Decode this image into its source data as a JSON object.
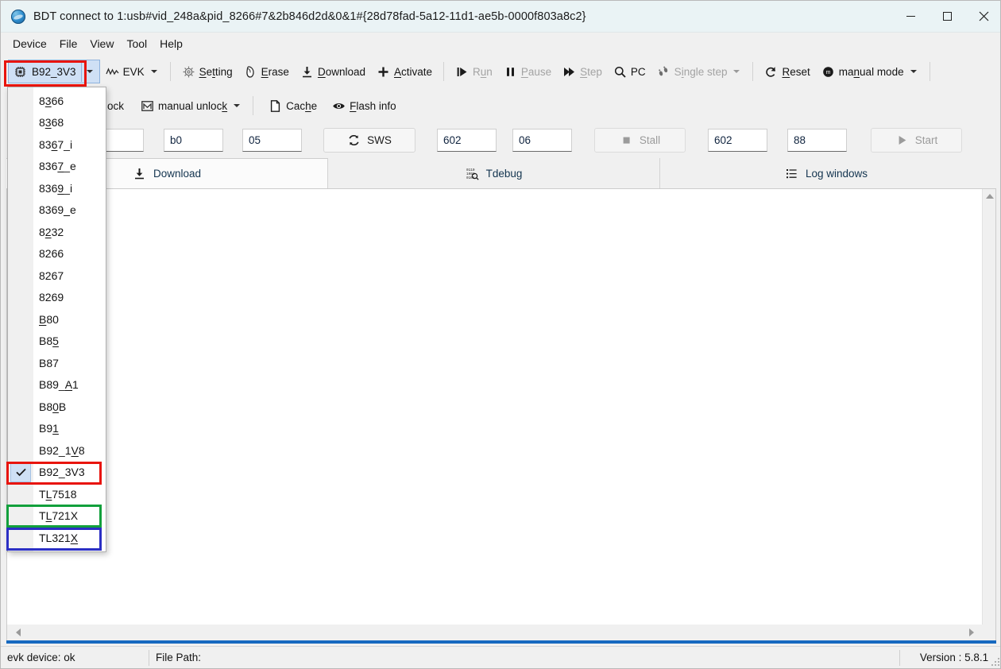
{
  "window": {
    "title": "BDT connect to 1:usb#vid_248a&pid_8266#7&2b846d2d&0&1#{28d78fad-5a12-11d1-ae5b-0000f803a8c2}",
    "app_icon": "globe-icon",
    "minimize_label": "─",
    "maximize_label": "□",
    "close_label": "✕"
  },
  "menubar": {
    "items": [
      {
        "label": "Device"
      },
      {
        "label": "File"
      },
      {
        "label": "View"
      },
      {
        "label": "Tool"
      },
      {
        "label": "Help"
      }
    ]
  },
  "toolbar_row1": {
    "chip": {
      "label": "B92_3V3",
      "icon": "chip-icon",
      "caret": "chevron-down-icon"
    },
    "evk": {
      "label": "EVK",
      "icon": "waveform-icon",
      "caret": "chevron-down-icon"
    },
    "setting": {
      "label": "Setting",
      "icon": "gear-icon"
    },
    "erase": {
      "label": "Erase",
      "icon": "eraser-icon"
    },
    "download": {
      "label": "Download",
      "icon": "download-arrow-icon"
    },
    "activate": {
      "label": "Activate",
      "icon": "plus-icon"
    },
    "run": {
      "label": "Run",
      "icon": "play-run-icon",
      "disabled": true
    },
    "pause": {
      "label": "Pause",
      "icon": "pause-icon",
      "disabled": true
    },
    "step": {
      "label": "Step",
      "icon": "step-forward-icon",
      "disabled": true
    },
    "pc": {
      "label": "PC",
      "icon": "magnifier-icon"
    },
    "single_step": {
      "label": "Single step",
      "icon": "footsteps-icon",
      "disabled": true,
      "caret": "chevron-down-icon"
    },
    "reset": {
      "label": "Reset",
      "icon": "reset-circular-arrow-icon"
    },
    "manual_mode": {
      "label": "manual mode",
      "icon": "mode-circle-icon",
      "caret": "chevron-down-icon"
    }
  },
  "toolbar_row2": {
    "lock": {
      "label": "ock",
      "icon": "lock-icon"
    },
    "manual_unlock": {
      "label": "manual unlock",
      "icon": "envelope-m-icon",
      "caret": "chevron-down-icon"
    },
    "cache": {
      "label": "Cache",
      "icon": "page-icon"
    },
    "flash_info": {
      "label": "Flash info",
      "icon": "eye-icon"
    }
  },
  "fields_row": {
    "field_addr0": {
      "value": "",
      "placeholder": ""
    },
    "field_b0": {
      "value": "b0"
    },
    "field_05": {
      "value": "05"
    },
    "sws_button": {
      "label": "SWS",
      "icon": "refresh-icon"
    },
    "field_602a": {
      "value": "602"
    },
    "field_06": {
      "value": "06"
    },
    "stall_button": {
      "label": "Stall",
      "icon": "stop-square-icon",
      "disabled": true
    },
    "field_602b": {
      "value": "602"
    },
    "field_88": {
      "value": "88"
    },
    "start_button": {
      "label": "Start",
      "icon": "play-triangle-icon",
      "disabled": true
    }
  },
  "tabs": {
    "items": [
      {
        "label": "Download",
        "icon": "download-arrow-icon",
        "active": true
      },
      {
        "label": "Tdebug",
        "icon": "binary-magnifier-icon",
        "active": false
      },
      {
        "label": "Log windows",
        "icon": "list-lines-icon",
        "active": false
      }
    ]
  },
  "content": {
    "vertical_scrollbar": {
      "up_icon": "scroll-up-arrow-icon",
      "down_icon": "scroll-down-arrow-icon"
    },
    "horizontal_scrollbar": {
      "left_icon": "scroll-left-arrow-icon",
      "right_icon": "scroll-right-arrow-icon"
    }
  },
  "statusbar": {
    "device_status": "evk device: ok",
    "file_path": "File Path:",
    "version": "Version : 5.8.1"
  },
  "dropdown": {
    "open": true,
    "items": [
      {
        "label": "8366",
        "mnemonic_index": 1,
        "checked": false
      },
      {
        "label": "8368",
        "mnemonic_index": 1,
        "checked": false
      },
      {
        "label": "8367_i",
        "mnemonic_index": 2,
        "checked": false
      },
      {
        "label": "8367_e",
        "mnemonic_index": 3,
        "checked": false
      },
      {
        "label": "8369_i",
        "mnemonic_index": 3,
        "checked": false
      },
      {
        "label": "8369_e",
        "mnemonic_index": 4,
        "checked": false
      },
      {
        "label": "8232",
        "mnemonic_index": 1,
        "checked": false
      },
      {
        "label": "8266",
        "mnemonic_index": -1,
        "checked": false
      },
      {
        "label": "8267",
        "mnemonic_index": -1,
        "checked": false
      },
      {
        "label": "8269",
        "mnemonic_index": -1,
        "checked": false
      },
      {
        "label": "B80",
        "mnemonic_index": 0,
        "checked": false
      },
      {
        "label": "B85",
        "mnemonic_index": 2,
        "checked": false
      },
      {
        "label": "B87",
        "mnemonic_index": -1,
        "checked": false
      },
      {
        "label": "B89_A1",
        "mnemonic_index": 4,
        "checked": false
      },
      {
        "label": "B80B",
        "mnemonic_index": 2,
        "checked": false
      },
      {
        "label": "B91",
        "mnemonic_index": 2,
        "checked": false
      },
      {
        "label": "B92_1V8",
        "mnemonic_index": 5,
        "checked": false
      },
      {
        "label": "B92_3V3",
        "mnemonic_index": -1,
        "checked": true
      },
      {
        "label": "TL7518",
        "mnemonic_index": 1,
        "checked": false
      },
      {
        "label": "TL721X",
        "mnemonic_index": 1,
        "checked": false
      },
      {
        "label": "TL321X",
        "mnemonic_index": 5,
        "checked": false
      }
    ],
    "check_icon": "checkmark-icon"
  },
  "annotations": {
    "colors": {
      "red": "#e8140c",
      "green": "#12a03c",
      "blue": "#2b2fc4"
    },
    "boxes": [
      {
        "name": "chip-selector-highlight",
        "color_key": "red"
      },
      {
        "name": "b92-3v3-item-highlight",
        "color_key": "red"
      },
      {
        "name": "tl721x-item-highlight",
        "color_key": "green"
      },
      {
        "name": "tl321x-item-highlight",
        "color_key": "blue"
      }
    ]
  }
}
